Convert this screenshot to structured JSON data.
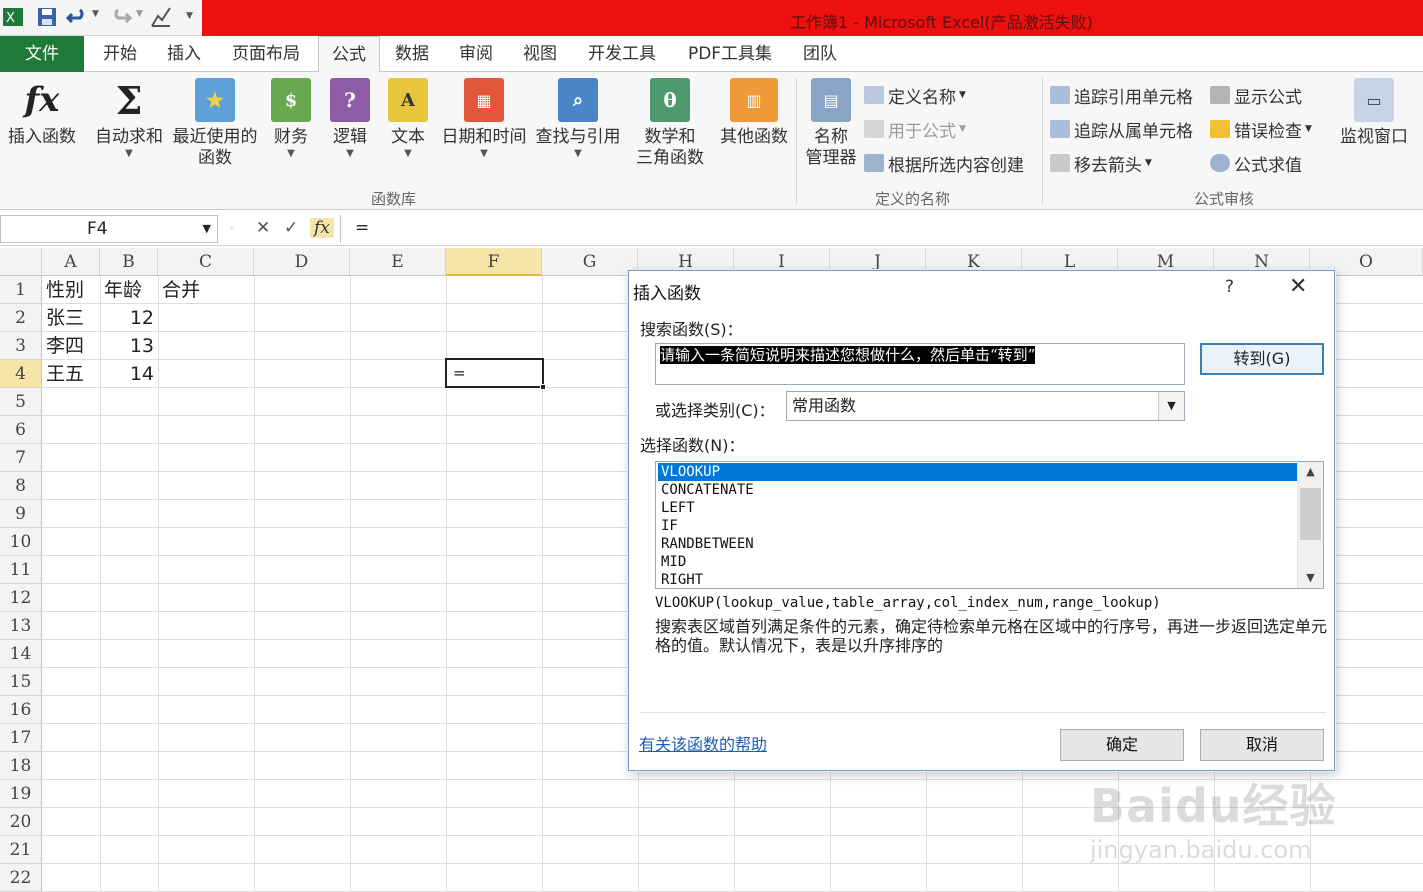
{
  "window": {
    "title": "工作簿1 - Microsoft Excel(产品激活失败)"
  },
  "tabs": [
    "文件",
    "开始",
    "插入",
    "页面布局",
    "公式",
    "数据",
    "审阅",
    "视图",
    "开发工具",
    "PDF工具集",
    "团队"
  ],
  "active_tab": "公式",
  "ribbon": {
    "function_library": {
      "group_label": "函数库",
      "buttons": [
        {
          "label": "插入函数",
          "icon": "fx-icon"
        },
        {
          "label": "自动求和",
          "icon": "sigma-icon"
        },
        {
          "label": "最近使用的",
          "label2": "函数",
          "icon": "book-star-icon"
        },
        {
          "label": "财务",
          "icon": "book-finance-icon"
        },
        {
          "label": "逻辑",
          "icon": "book-question-icon"
        },
        {
          "label": "文本",
          "icon": "book-text-icon"
        },
        {
          "label": "日期和时间",
          "icon": "book-calendar-icon"
        },
        {
          "label": "查找与引用",
          "icon": "book-search-icon"
        },
        {
          "label": "数学和",
          "label2": "三角函数",
          "icon": "book-theta-icon"
        },
        {
          "label": "其他函数",
          "icon": "books-more-icon"
        }
      ]
    },
    "defined_names": {
      "group_label": "定义的名称",
      "name_manager": {
        "label": "名称",
        "label2": "管理器"
      },
      "define_name": "定义名称",
      "use_in_formula": "用于公式",
      "create_from_selection": "根据所选内容创建"
    },
    "formula_auditing": {
      "group_label": "公式审核",
      "trace_precedents": "追踪引用单元格",
      "trace_dependents": "追踪从属单元格",
      "remove_arrows": "移去箭头",
      "show_formulas": "显示公式",
      "error_checking": "错误检查",
      "evaluate_formula": "公式求值",
      "watch_window": "监视窗口"
    }
  },
  "formula_bar": {
    "name_box": "F4",
    "content": "="
  },
  "columns": [
    "A",
    "B",
    "C",
    "D",
    "E",
    "F",
    "G",
    "H",
    "I",
    "J",
    "K",
    "L",
    "M",
    "N",
    "O"
  ],
  "rows": [
    "1",
    "2",
    "3",
    "4",
    "5",
    "6",
    "7",
    "8",
    "9",
    "10",
    "11",
    "12",
    "13",
    "14",
    "15",
    "16",
    "17",
    "18",
    "19",
    "20",
    "21",
    "22"
  ],
  "cells": {
    "A1": "性别",
    "B1": "年龄",
    "C1": "合并",
    "A2": "张三",
    "B2": "12",
    "A3": "李四",
    "B3": "13",
    "A4": "王五",
    "B4": "14",
    "F4": "="
  },
  "dialog": {
    "title": "插入函数",
    "help_glyph": "?",
    "close_glyph": "✕",
    "search_label": "搜索函数(S)：",
    "search_placeholder": "请输入一条简短说明来描述您想做什么，然后单击“转到”",
    "goto_button": "转到(G)",
    "category_label": "或选择类别(C)：",
    "category_value": "常用函数",
    "select_label": "选择函数(N)：",
    "functions": [
      "VLOOKUP",
      "CONCATENATE",
      "LEFT",
      "IF",
      "RANDBETWEEN",
      "MID",
      "RIGHT"
    ],
    "selected_function": "VLOOKUP",
    "signature": "VLOOKUP(lookup_value,table_array,col_index_num,range_lookup)",
    "description": "搜索表区域首列满足条件的元素，确定待检索单元格在区域中的行序号，再进一步返回选定单元格的值。默认情况下，表是以升序排序的",
    "help_link": "有关该函数的帮助",
    "ok_button": "确定",
    "cancel_button": "取消"
  },
  "watermark": {
    "line1": "Baidu经验",
    "line2": "jingyan.baidu.com"
  },
  "colors": {
    "title_red": "#ee0f0f",
    "file_tab": "#1f7a3a",
    "selection_blue": "#0078d7",
    "header_highlight": "#f6e5a8"
  }
}
